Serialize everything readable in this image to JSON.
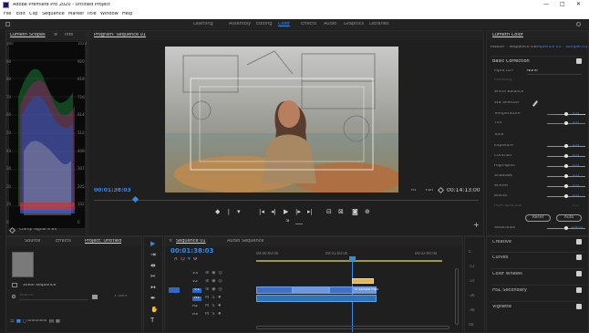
{
  "app": {
    "title": "Adobe Premiere Pro 2020 - Untitled Project",
    "window_controls": [
      "—",
      "□",
      "✕"
    ]
  },
  "menu": [
    "File",
    "Edit",
    "Clip",
    "Sequence",
    "Marker",
    "Title",
    "Window",
    "Help"
  ],
  "workspaces": [
    "Learning",
    "Assembly",
    "Editing",
    "Color",
    "Effects",
    "Audio",
    "Graphics",
    "Libraries"
  ],
  "lumetri_scopes": {
    "tab_label": "Lumetri Scopes",
    "menu_glyph": "≡",
    "second_tab": "Info",
    "left_scale": [
      "100",
      "90",
      "80",
      "70",
      "60",
      "50",
      "40",
      "30",
      "20",
      "10",
      "0"
    ],
    "right_scale": [
      "1023",
      "920",
      "818",
      "716",
      "614",
      "512",
      "409",
      "307",
      "205",
      "102",
      "0"
    ],
    "footer": "Clamp Signal  8 Bit"
  },
  "program_monitor": {
    "tab_label": "Program: Sequence 01",
    "timecode_in": "00:01:38:03",
    "fit_label": "Fit",
    "quality_label": "Full",
    "timecode_duration": "00:14:13:00"
  },
  "lumetri_color": {
    "tab_label": "Lumetri Color",
    "clip_selector": "Master * Sequence 01",
    "clip_selector_right": "Sequence 01 * sample.mp4",
    "basic_correction_label": "Basic Correction",
    "input_lut_label": "Input LUT",
    "input_lut_value": "None",
    "intensity_label": "Intensity",
    "white_balance_label": "White Balance",
    "wb_selector_label": "WB Selector",
    "temperature_label": "Temperature",
    "temperature_value": "0.0",
    "tint_label": "Tint",
    "tint_value": "0.0",
    "tone_label": "Tone",
    "tone": [
      {
        "label": "Exposure",
        "value": "0.0"
      },
      {
        "label": "Contrast",
        "value": "0.0"
      },
      {
        "label": "Highlights",
        "value": "0.0"
      },
      {
        "label": "Shadows",
        "value": "0.0"
      },
      {
        "label": "Whites",
        "value": "0.0"
      },
      {
        "label": "Blacks",
        "value": "0.0"
      },
      {
        "label": "HDR Specular",
        "value": "0.0"
      }
    ],
    "reset_label": "Reset",
    "auto_label": "Auto",
    "saturation_label": "Saturation",
    "saturation_value": "100.0",
    "sections": [
      "Creative",
      "Curves",
      "Color Wheels",
      "HSL Secondary",
      "Vignette"
    ]
  },
  "project": {
    "tabs": [
      "Source",
      "Effects",
      "Project: Untitled"
    ],
    "item_label": "Video Sequence",
    "search_placeholder": "Search",
    "count_label": "1 Item"
  },
  "timeline": {
    "tab_label": "Sequence 01",
    "close_glyph": "×",
    "other_tab": "Audio Sequence",
    "timecode": "00:01:38:03",
    "ruler": [
      "00:00:00:00",
      "00:01:00:00",
      "00:02:00:00"
    ],
    "tracks": [
      "V3",
      "V2",
      "V1",
      "A1",
      "A2",
      "A3"
    ],
    "clip_label": "fx sample.mp4",
    "audio_levels": [
      "0",
      "-12",
      "-24",
      "-36",
      "-48",
      "dB"
    ]
  },
  "colors": {
    "accent": "#2d8ceb",
    "timecode": "#3b8ae4",
    "clip_video": "#4070c6",
    "clip_audio": "#2f74b8",
    "clip_label": "#e2b654"
  }
}
